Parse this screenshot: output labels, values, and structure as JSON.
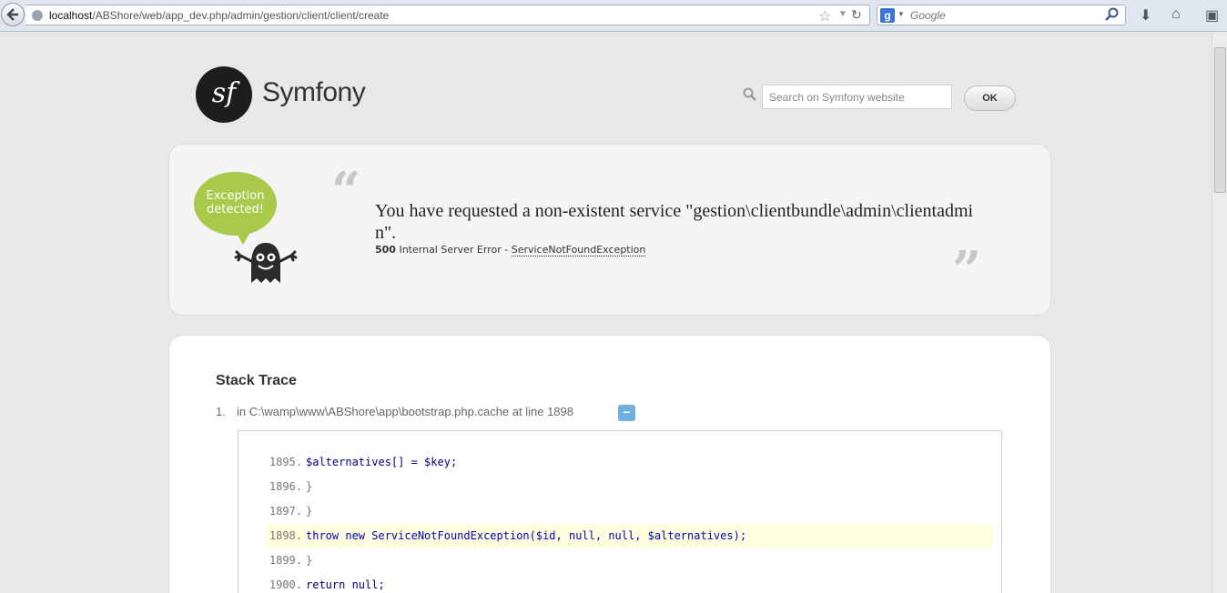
{
  "browser": {
    "url_host": "localhost",
    "url_path": "/ABShore/web/app_dev.php/admin/gestion/client/client/create",
    "search_engine": "Google"
  },
  "header": {
    "logo_mark": "sf",
    "logo_text": "Symfony",
    "search_placeholder": "Search on Symfony website",
    "ok_label": "OK"
  },
  "exception": {
    "badge_line1": "Exception",
    "badge_line2": "detected!",
    "message": "You have requested a non-existent service \"gestion\\clientbundle\\admin\\clientadmin\".",
    "status_code": "500",
    "status_text": "Internal Server Error -",
    "exception_class": "ServiceNotFoundException"
  },
  "stack_trace": {
    "title": "Stack Trace",
    "item_number": "1.",
    "location": "in C:\\wamp\\www\\ABShore\\app\\bootstrap.php.cache at line 1898",
    "toggle_label": "−",
    "lines": [
      {
        "num": "1895.",
        "code": "$alternatives[] = $key;"
      },
      {
        "num": "1896.",
        "code": "}"
      },
      {
        "num": "1897.",
        "code": "}"
      },
      {
        "num": "1898.",
        "code": "throw new ServiceNotFoundException($id, null, null, $alternatives);"
      },
      {
        "num": "1899.",
        "code": "}"
      },
      {
        "num": "1900.",
        "code": "return null;"
      }
    ]
  }
}
